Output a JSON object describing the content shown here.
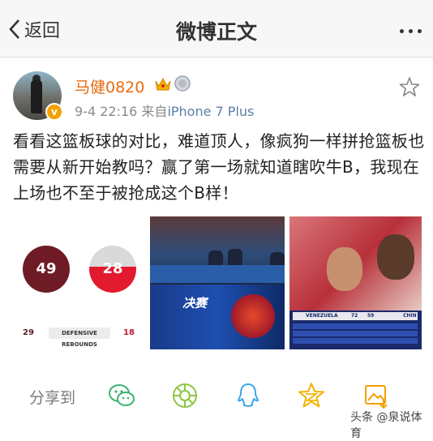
{
  "nav": {
    "back_label": "返回",
    "title": "微博正文"
  },
  "post": {
    "username": "马健0820",
    "date": "9-4 22:16",
    "source_prefix": "来自",
    "source": "iPhone 7 Plus",
    "text": "看看这篮板球的对比，难道顶人，像疯狗一样拼抢篮板也需要从新开始教吗？赢了第一场就知道瞎吹牛B，我现在上场也不至于被抢成这个B样！"
  },
  "image1": {
    "left_value": "49",
    "right_value": "28",
    "left_small": "29",
    "stat_label": "DEFENSIVE REBOUNDS",
    "right_small": "18",
    "left_color": "#6e1b25",
    "right_color": "#e31a2d"
  },
  "image3": {
    "team_left": "VENEZUELA",
    "score_left": "72",
    "score_right": "59",
    "team_right": "CHIN"
  },
  "share": {
    "label": "分享到",
    "icons": [
      "wechat-icon",
      "moments-icon",
      "qq-icon",
      "qzone-icon",
      "save-image-icon"
    ]
  },
  "watermark": "头条 @泉说体育"
}
